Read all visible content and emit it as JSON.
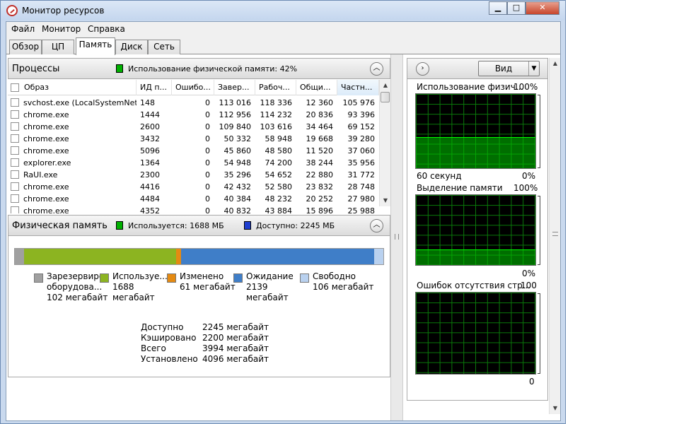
{
  "window": {
    "title": "Монитор ресурсов",
    "minimize": "▁",
    "maximize": "□",
    "close": "✕"
  },
  "menu": [
    "Файл",
    "Монитор",
    "Справка"
  ],
  "tabs": [
    "Обзор",
    "ЦП",
    "Память",
    "Диск",
    "Сеть"
  ],
  "active_tab": "Память",
  "processes": {
    "title": "Процессы",
    "legend_text": "Использование физической памяти: 42%",
    "legend_color": "#00b000",
    "columns": [
      "Образ",
      "ИД п...",
      "Ошибо...",
      "Завер...",
      "Рабоч...",
      "Общи...",
      "Частн..."
    ],
    "rows": [
      [
        "svchost.exe (LocalSystemNet...",
        "148",
        "0",
        "113 016",
        "118 336",
        "12 360",
        "105 976"
      ],
      [
        "chrome.exe",
        "1444",
        "0",
        "112 956",
        "114 232",
        "20 836",
        "93 396"
      ],
      [
        "chrome.exe",
        "2600",
        "0",
        "109 840",
        "103 616",
        "34 464",
        "69 152"
      ],
      [
        "chrome.exe",
        "3432",
        "0",
        "50 332",
        "58 948",
        "19 668",
        "39 280"
      ],
      [
        "chrome.exe",
        "5096",
        "0",
        "45 860",
        "48 580",
        "11 520",
        "37 060"
      ],
      [
        "explorer.exe",
        "1364",
        "0",
        "54 948",
        "74 200",
        "38 244",
        "35 956"
      ],
      [
        "RaUI.exe",
        "2300",
        "0",
        "35 296",
        "54 652",
        "22 880",
        "31 772"
      ],
      [
        "chrome.exe",
        "4416",
        "0",
        "42 432",
        "52 580",
        "23 832",
        "28 748"
      ],
      [
        "chrome.exe",
        "4484",
        "0",
        "40 384",
        "48 232",
        "20 252",
        "27 980"
      ],
      [
        "chrome.exe",
        "4352",
        "0",
        "40 832",
        "43 884",
        "15 896",
        "25 988"
      ]
    ]
  },
  "physical": {
    "title": "Физическая память",
    "in_use_label": "Используется: 1688 МБ",
    "in_use_color": "#00b000",
    "available_label": "Доступно: 2245 МБ",
    "available_color": "#1f3fd0",
    "bar_segments_mb": {
      "reserved": 102,
      "in_use": 1688,
      "modified": 61,
      "standby": 2139,
      "free": 106
    },
    "legend": [
      {
        "lines": [
          "Зарезервиров",
          "оборудова...",
          "102 мегабайт"
        ],
        "color": "#a0a0a0"
      },
      {
        "lines": [
          "Используе...",
          "1688",
          "мегабайт"
        ],
        "color": "#8cb421"
      },
      {
        "lines": [
          "Изменено",
          "61 мегабайт"
        ],
        "color": "#e58a12"
      },
      {
        "lines": [
          "Ожидание",
          "2139",
          "мегабайт"
        ],
        "color": "#3f7ec8"
      },
      {
        "lines": [
          "Свободно",
          "106 мегабайт"
        ],
        "color": "#b9d1ef"
      }
    ],
    "stats": [
      {
        "label": "Доступно",
        "value": "2245 мегабайт"
      },
      {
        "label": "Кэшировано",
        "value": "2200 мегабайт"
      },
      {
        "label": "Всего",
        "value": "3994 мегабайт"
      },
      {
        "label": "Установлено",
        "value": "4096 мегабайт"
      }
    ]
  },
  "right": {
    "view_button": "Вид",
    "graphs": [
      {
        "title": "Использование физич...",
        "max": "100%",
        "footer_left": "60 секунд",
        "footer_right": "0%",
        "level": 0.42
      },
      {
        "title": "Выделение памяти",
        "max": "100%",
        "footer_left": "",
        "footer_right": "0%",
        "level": 0.22
      },
      {
        "title": "Ошибок отсутствия стр...",
        "max": "100",
        "footer_left": "",
        "footer_right": "0",
        "level": 0.0
      }
    ]
  }
}
